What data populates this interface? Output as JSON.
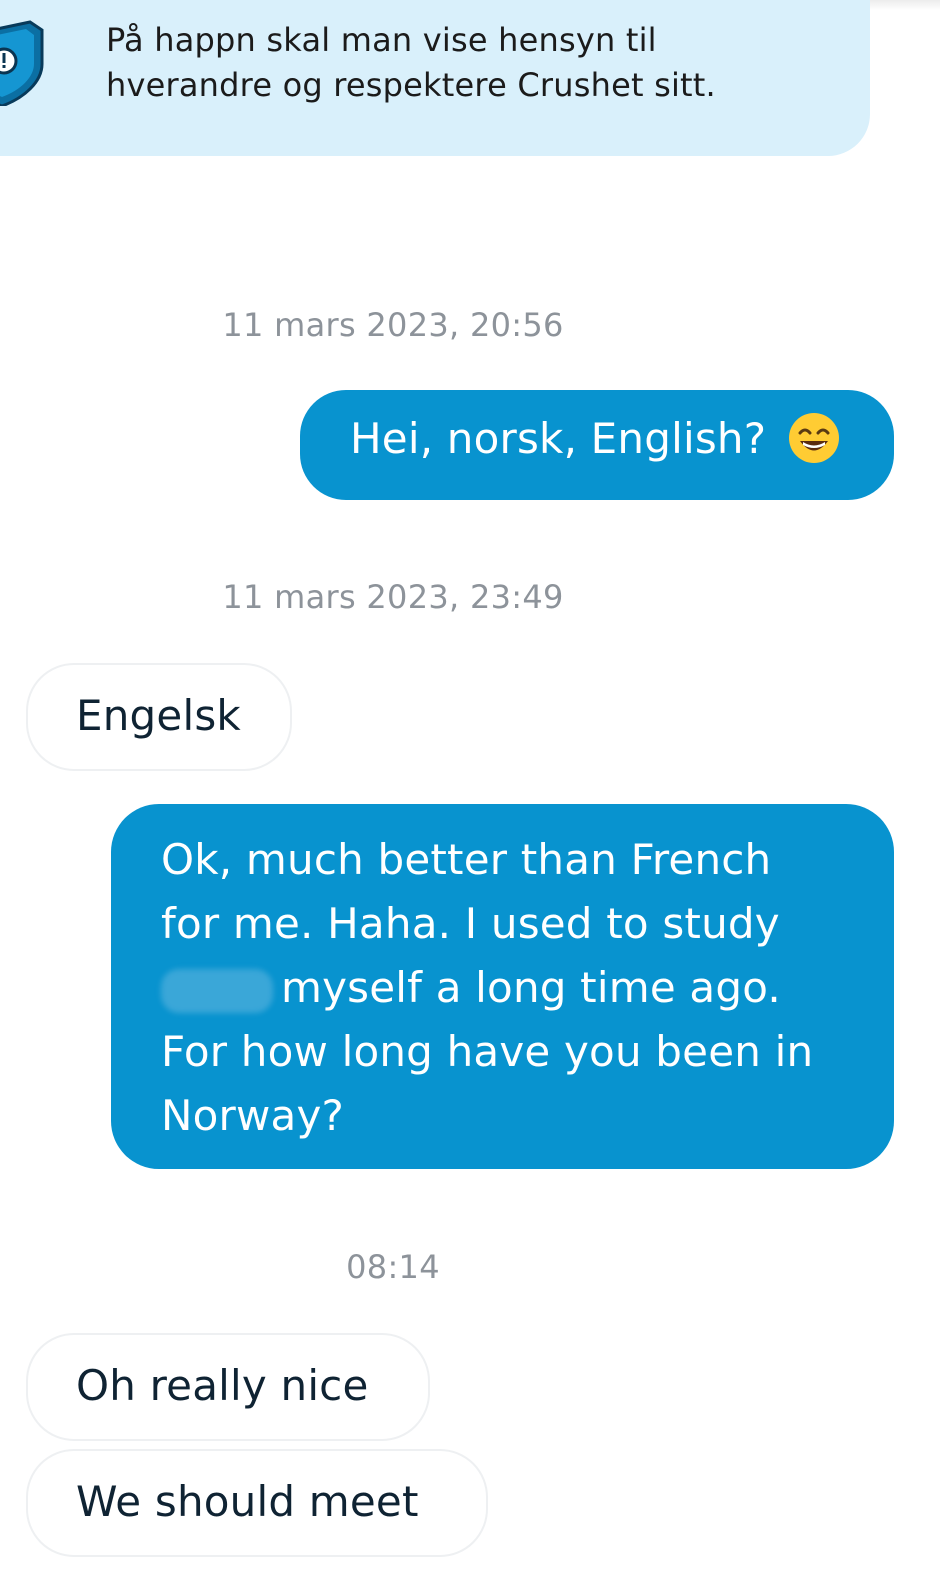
{
  "banner": {
    "icon": "shield-warning-icon",
    "line1": "På happn skal man vise hensyn til",
    "line2": "hverandre og respektere Crushet sitt."
  },
  "timestamps": [
    "11 mars 2023, 20:56",
    "11 mars 2023, 23:49",
    "08:14"
  ],
  "messages": [
    {
      "direction": "sent",
      "text": "Hei, norsk, English?",
      "emoji": "grinning-face-icon"
    },
    {
      "direction": "received",
      "text": "Engelsk"
    },
    {
      "direction": "sent",
      "lines": [
        "Ok, much better than French",
        "for me. Haha. I used to study",
        "myself a long time ago.",
        "For how long have you been in",
        "Norway?"
      ],
      "redacted_word": true
    },
    {
      "direction": "received",
      "text": "Oh really nice"
    },
    {
      "direction": "received",
      "text": "We should meet"
    }
  ],
  "colors": {
    "sent_bubble": "#0893cf",
    "banner_bg": "#d9f0fb",
    "timestamp": "#8d939a",
    "received_text": "#0f2333"
  }
}
